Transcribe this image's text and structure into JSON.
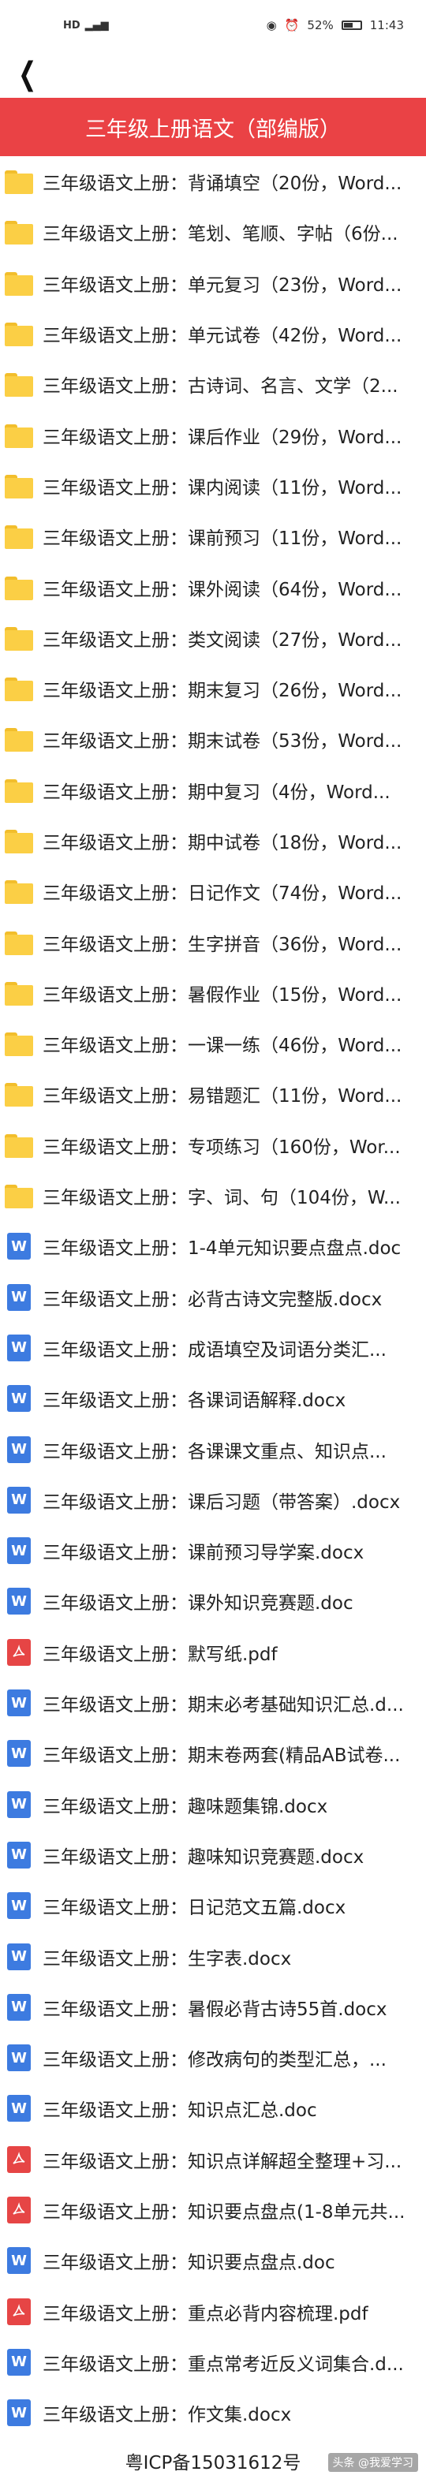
{
  "status": {
    "left": "HD",
    "battery": "52%",
    "time": "11:43"
  },
  "header": {
    "back_icon": "chevron-left-icon",
    "title": "三年级上册语文（部编版）"
  },
  "items": [
    {
      "type": "folder",
      "name": "三年级语文上册：背诵填空（20份，Word..."
    },
    {
      "type": "folder",
      "name": "三年级语文上册：笔划、笔顺、字帖（6份..."
    },
    {
      "type": "folder",
      "name": "三年级语文上册：单元复习（23份，Word..."
    },
    {
      "type": "folder",
      "name": "三年级语文上册：单元试卷（42份，Word..."
    },
    {
      "type": "folder",
      "name": "三年级语文上册：古诗词、名言、文学（2..."
    },
    {
      "type": "folder",
      "name": "三年级语文上册：课后作业（29份，Word..."
    },
    {
      "type": "folder",
      "name": "三年级语文上册：课内阅读（11份，Word..."
    },
    {
      "type": "folder",
      "name": "三年级语文上册：课前预习（11份，Word..."
    },
    {
      "type": "folder",
      "name": "三年级语文上册：课外阅读（64份，Word..."
    },
    {
      "type": "folder",
      "name": "三年级语文上册：类文阅读（27份，Word..."
    },
    {
      "type": "folder",
      "name": "三年级语文上册：期末复习（26份，Word..."
    },
    {
      "type": "folder",
      "name": "三年级语文上册：期末试卷（53份，Word..."
    },
    {
      "type": "folder",
      "name": "三年级语文上册：期中复习（4份，Word..."
    },
    {
      "type": "folder",
      "name": "三年级语文上册：期中试卷（18份，Word..."
    },
    {
      "type": "folder",
      "name": "三年级语文上册：日记作文（74份，Word..."
    },
    {
      "type": "folder",
      "name": "三年级语文上册：生字拼音（36份，Word..."
    },
    {
      "type": "folder",
      "name": "三年级语文上册：暑假作业（15份，Word..."
    },
    {
      "type": "folder",
      "name": "三年级语文上册：一课一练（46份，Word..."
    },
    {
      "type": "folder",
      "name": "三年级语文上册：易错题汇（11份，Word..."
    },
    {
      "type": "folder",
      "name": "三年级语文上册：专项练习（160份，Wor..."
    },
    {
      "type": "folder",
      "name": "三年级语文上册：字、词、句（104份，W..."
    },
    {
      "type": "word",
      "name": "三年级语文上册：1-4单元知识要点盘点.doc"
    },
    {
      "type": "word",
      "name": "三年级语文上册：必背古诗文完整版.docx"
    },
    {
      "type": "word",
      "name": "三年级语文上册：成语填空及词语分类汇..."
    },
    {
      "type": "word",
      "name": "三年级语文上册：各课词语解释.docx"
    },
    {
      "type": "word",
      "name": "三年级语文上册：各课课文重点、知识点..."
    },
    {
      "type": "word",
      "name": "三年级语文上册：课后习题（带答案）.docx"
    },
    {
      "type": "word",
      "name": "三年级语文上册：课前预习导学案.docx"
    },
    {
      "type": "word",
      "name": "三年级语文上册：课外知识竞赛题.doc"
    },
    {
      "type": "pdf",
      "name": "三年级语文上册：默写纸.pdf"
    },
    {
      "type": "word",
      "name": "三年级语文上册：期末必考基础知识汇总.d..."
    },
    {
      "type": "word",
      "name": "三年级语文上册：期末卷两套(精品AB试卷..."
    },
    {
      "type": "word",
      "name": "三年级语文上册：趣味题集锦.docx"
    },
    {
      "type": "word",
      "name": "三年级语文上册：趣味知识竞赛题.docx"
    },
    {
      "type": "word",
      "name": "三年级语文上册：日记范文五篇.docx"
    },
    {
      "type": "word",
      "name": "三年级语文上册：生字表.docx"
    },
    {
      "type": "word",
      "name": "三年级语文上册：暑假必背古诗55首.docx"
    },
    {
      "type": "word",
      "name": "三年级语文上册：修改病句的类型汇总，..."
    },
    {
      "type": "word",
      "name": "三年级语文上册：知识点汇总.doc"
    },
    {
      "type": "pdf",
      "name": "三年级语文上册：知识点详解超全整理+习..."
    },
    {
      "type": "pdf",
      "name": "三年级语文上册：知识要点盘点(1-8单元共..."
    },
    {
      "type": "word",
      "name": "三年级语文上册：知识要点盘点.doc"
    },
    {
      "type": "pdf",
      "name": "三年级语文上册：重点必背内容梳理.pdf"
    },
    {
      "type": "word",
      "name": "三年级语文上册：重点常考近反义词集合.d..."
    },
    {
      "type": "word",
      "name": "三年级语文上册：作文集.docx"
    }
  ],
  "footer": {
    "icp": "粤ICP备15031612号",
    "watermark": "头条 @我爱学习"
  },
  "icons": {
    "word_letter": "W",
    "folder": "folder-icon",
    "pdf": "pdf-icon"
  },
  "colors": {
    "title_bar": "#ea4245",
    "folder": "#fbcf45",
    "word": "#3d7be0",
    "pdf": "#e64545"
  }
}
